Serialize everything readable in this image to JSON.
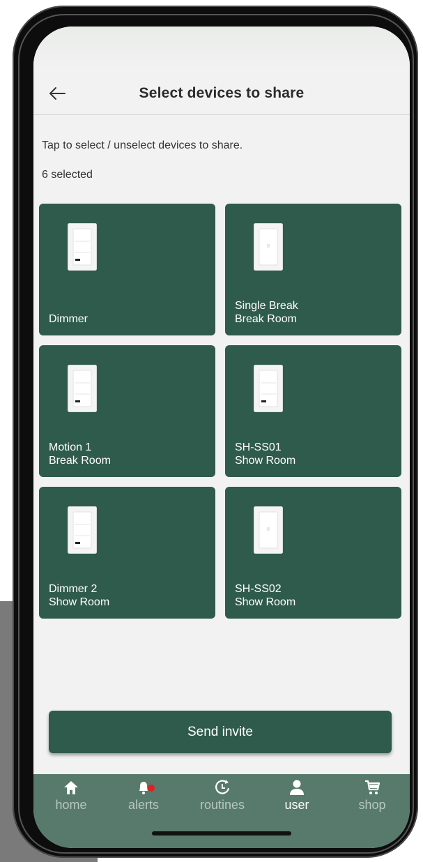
{
  "header": {
    "title": "Select devices to share",
    "back_icon": "arrow-left-icon"
  },
  "instruction": "Tap to select / unselect devices to share.",
  "selected_count": "6 selected",
  "devices": [
    {
      "line1": "Dimmer",
      "line2": "",
      "type": "dimmer"
    },
    {
      "line1": "Single Break",
      "line2": "Break Room",
      "type": "switch"
    },
    {
      "line1": "Motion 1",
      "line2": "Break Room",
      "type": "dimmer"
    },
    {
      "line1": "SH-SS01",
      "line2": "Show Room",
      "type": "switch"
    },
    {
      "line1": "Dimmer 2",
      "line2": "Show Room",
      "type": "dimmer"
    },
    {
      "line1": "SH-SS02",
      "line2": "Show Room",
      "type": "switch"
    }
  ],
  "send_button": "Send invite",
  "tabs": [
    {
      "label": "home",
      "icon": "home-icon",
      "active": false
    },
    {
      "label": "alerts",
      "icon": "bell-icon",
      "active": false,
      "badge_color": "#e02020"
    },
    {
      "label": "routines",
      "icon": "clock-icon",
      "active": false
    },
    {
      "label": "user",
      "icon": "user-icon",
      "active": true
    },
    {
      "label": "shop",
      "icon": "cart-icon",
      "active": false
    }
  ],
  "colors": {
    "tile_bg": "#2f5b4d",
    "tabbar_bg": "#577a6c",
    "screen_bg": "#f2f2f2"
  }
}
